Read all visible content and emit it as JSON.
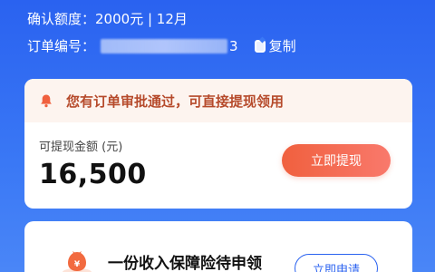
{
  "header": {
    "confirm_label": "确认额度：",
    "confirm_value": "2000元 | 12月",
    "order_label": "订单编号：",
    "order_suffix": "3",
    "copy_label": "复制"
  },
  "notice": {
    "text": "您有订单审批通过，可直接提现领用",
    "icon": "bell-icon"
  },
  "withdraw": {
    "label": "可提现金额 (元)",
    "amount": "16,500",
    "button": "立即提现"
  },
  "insurance": {
    "title": "一份收入保障险待申领",
    "button": "立即申请",
    "icon": "money-bag-icon"
  },
  "colors": {
    "primary_blue": "#2a62f0",
    "accent_orange": "#f0603e",
    "notice_bg": "#fdf4ef",
    "notice_text": "#b64a2b"
  }
}
